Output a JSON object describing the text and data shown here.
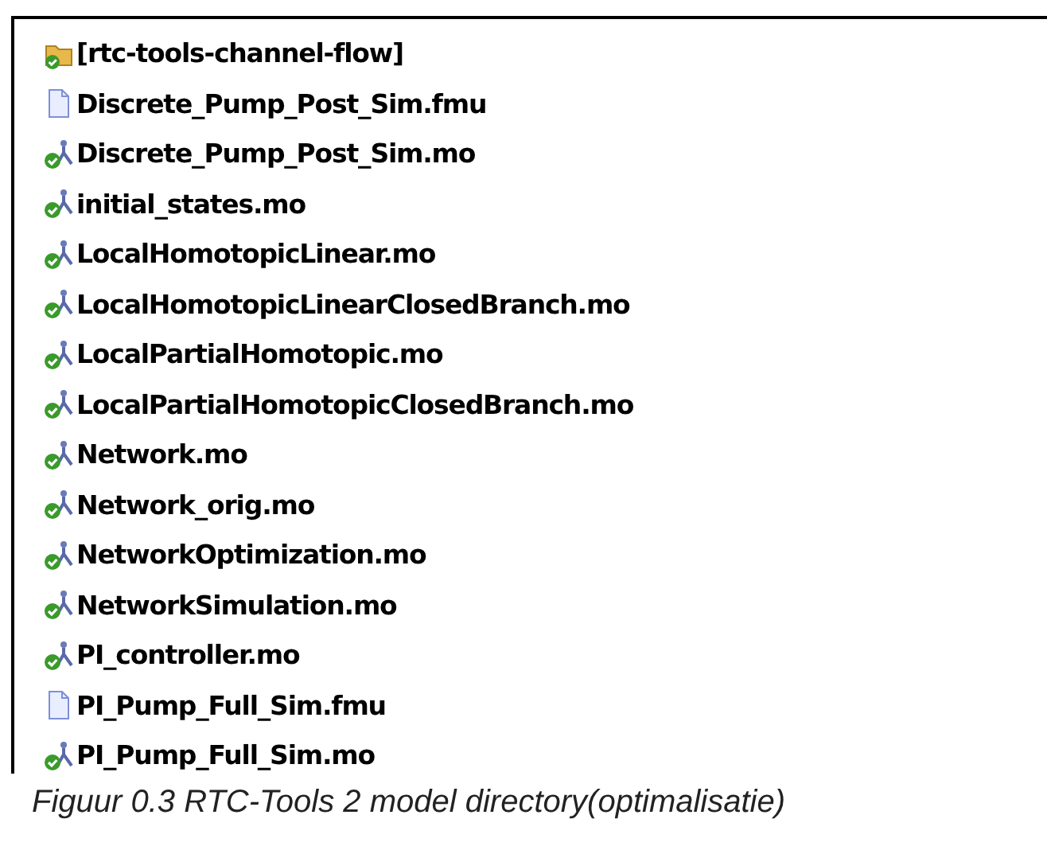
{
  "files": [
    {
      "name": "[rtc-tools-channel-flow]",
      "kind": "folder"
    },
    {
      "name": "Discrete_Pump_Post_Sim.fmu",
      "kind": "file"
    },
    {
      "name": "Discrete_Pump_Post_Sim.mo",
      "kind": "model"
    },
    {
      "name": "initial_states.mo",
      "kind": "model"
    },
    {
      "name": "LocalHomotopicLinear.mo",
      "kind": "model"
    },
    {
      "name": "LocalHomotopicLinearClosedBranch.mo",
      "kind": "model"
    },
    {
      "name": "LocalPartialHomotopic.mo",
      "kind": "model"
    },
    {
      "name": "LocalPartialHomotopicClosedBranch.mo",
      "kind": "model"
    },
    {
      "name": "Network.mo",
      "kind": "model"
    },
    {
      "name": "Network_orig.mo",
      "kind": "model"
    },
    {
      "name": "NetworkOptimization.mo",
      "kind": "model"
    },
    {
      "name": "NetworkSimulation.mo",
      "kind": "model"
    },
    {
      "name": "PI_controller.mo",
      "kind": "model"
    },
    {
      "name": "PI_Pump_Full_Sim.fmu",
      "kind": "file"
    },
    {
      "name": "PI_Pump_Full_Sim.mo",
      "kind": "model"
    }
  ],
  "caption": "Figuur 0.3 RTC-Tools 2 model directory(optimalisatie)"
}
